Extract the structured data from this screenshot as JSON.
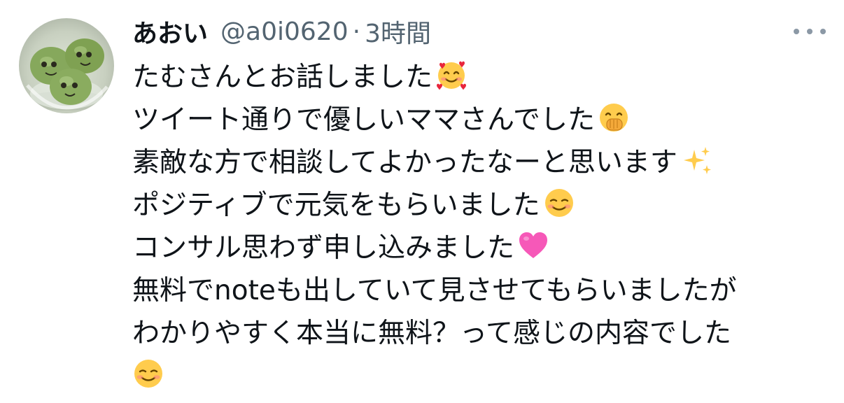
{
  "tweet": {
    "author": {
      "display_name": "あおい",
      "handle": "@a0i0620",
      "separator": "·",
      "time": "3時間"
    },
    "lines": [
      {
        "text": "たむさんとお話しました",
        "emoji": "smiling-face-with-hearts-icon"
      },
      {
        "text": "ツイート通りで優しいママさんでした",
        "emoji": "face-with-hand-over-mouth-icon"
      },
      {
        "text": "素敵な方で相談してよかったなーと思います",
        "emoji": "sparkles-icon"
      },
      {
        "text": "ポジティブで元気をもらいました",
        "emoji": "smiling-face-icon"
      },
      {
        "text": "コンサル思わず申し込みました",
        "emoji": "pink-heart-icon"
      },
      {
        "text": "無料でnoteも出していて見させてもらいましたが",
        "emoji": null
      },
      {
        "text": "わかりやすく本当に無料？って感じの内容でした",
        "emoji": null
      },
      {
        "text": "",
        "emoji": "smiling-face-icon"
      }
    ]
  },
  "colors": {
    "primary_text": "#0f1419",
    "secondary_text": "#536471",
    "more_dots": "#8b98a5"
  }
}
